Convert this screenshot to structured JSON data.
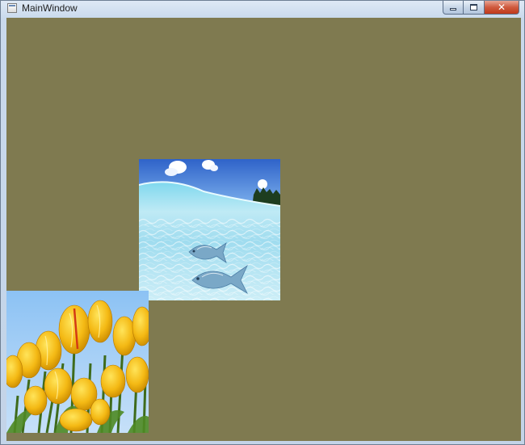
{
  "window": {
    "title": "MainWindow",
    "icons": {
      "app": "window-icon",
      "minimize": "minimize-icon",
      "maximize": "maximize-icon",
      "close": "close-icon"
    },
    "close_glyph": "✕"
  },
  "client": {
    "background_color": "#7F7A50",
    "images": [
      {
        "name": "underwater-fish-image",
        "subject": "underwater-fish"
      },
      {
        "name": "yellow-tulips-image",
        "subject": "yellow-tulips"
      }
    ]
  }
}
